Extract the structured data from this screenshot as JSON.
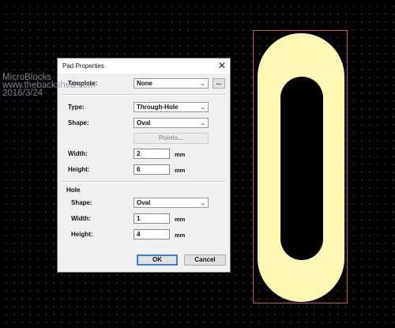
{
  "watermark": {
    "line1": "MicroBlocks",
    "line2": "www.thebackshed.com",
    "line3": "2016/3/24"
  },
  "dialog": {
    "title": "Pad Properties",
    "close_glyph": "✕",
    "template": {
      "label": "Template:",
      "value": "None",
      "browse_label": "..."
    },
    "type": {
      "label": "Type:",
      "value": "Through-Hole"
    },
    "shape": {
      "label": "Shape:",
      "value": "Oval"
    },
    "points_button": "Points...",
    "width": {
      "label": "Width:",
      "value": "2",
      "unit": "mm"
    },
    "height": {
      "label": "Height:",
      "value": "6",
      "unit": "mm"
    },
    "hole": {
      "section_label": "Hole",
      "shape": {
        "label": "Shape:",
        "value": "Oval"
      },
      "width": {
        "label": "Width:",
        "value": "1",
        "unit": "mm"
      },
      "height": {
        "label": "Height:",
        "value": "4",
        "unit": "mm"
      }
    },
    "ok_label": "OK",
    "cancel_label": "Cancel",
    "dropdown_glyph": "⌄"
  },
  "colors": {
    "pad_fill": "#fdf8b4",
    "selection_frame": "#c8553f",
    "canvas": "#000000"
  }
}
